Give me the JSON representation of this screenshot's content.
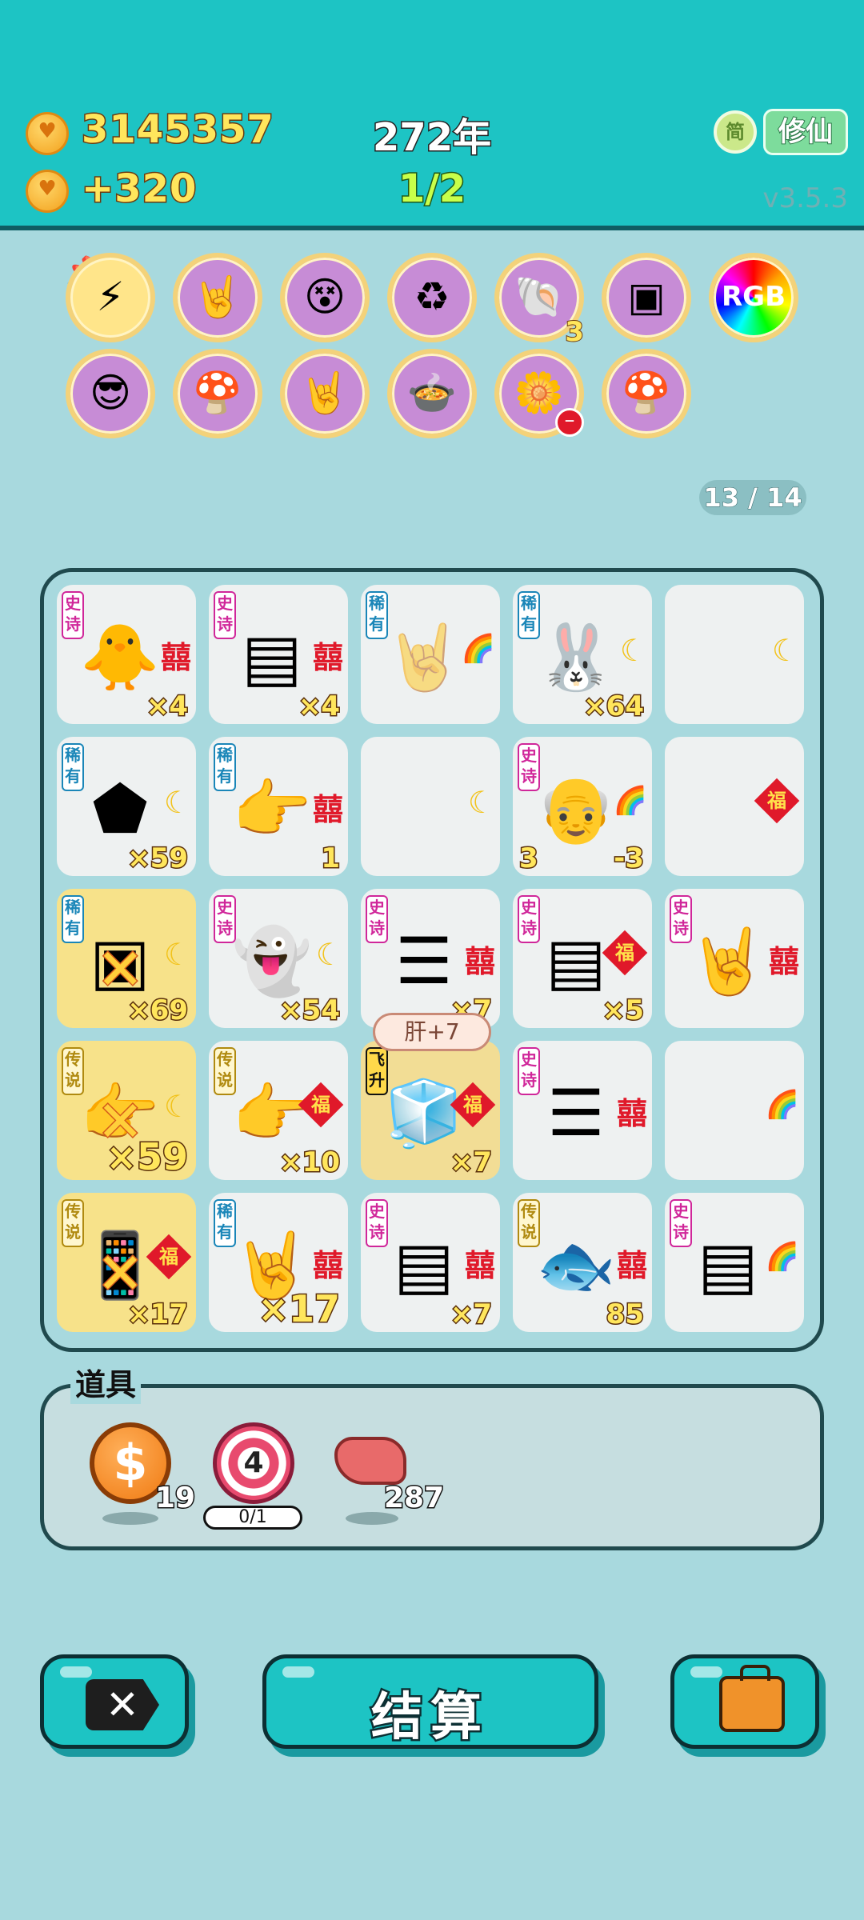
{
  "header": {
    "gold": "3145357",
    "income": "+320",
    "year": "272年",
    "round": "1/2",
    "simplified_label": "简",
    "mode_label": "修仙",
    "version": "v3.5.3"
  },
  "colors": {
    "header_bg": "#1dc4c4",
    "page_bg": "#a8d9de",
    "epic_tag": "#d0279a",
    "rare_tag": "#1a86b8",
    "legend_tag": "#b08a10",
    "gold_text": "#ffe65c"
  },
  "items": {
    "row1": [
      {
        "icon": "lightning-icon",
        "glyph": "⚡"
      },
      {
        "icon": "rock-hand-icon",
        "glyph": "🤘"
      },
      {
        "icon": "confused-face-icon",
        "glyph": "😵"
      },
      {
        "icon": "recycle-icon",
        "glyph": "♻"
      },
      {
        "icon": "shell-icon",
        "glyph": "🐚",
        "badge": "3"
      },
      {
        "icon": "cpu-chip-icon",
        "glyph": "▣"
      },
      {
        "icon": "rgb-icon",
        "glyph": "RGB"
      }
    ],
    "row2": [
      {
        "icon": "cool-peach-icon",
        "glyph": "😎"
      },
      {
        "icon": "mushroom-cloud-icon",
        "glyph": "🍄"
      },
      {
        "icon": "rock-hand-icon",
        "glyph": "🤘"
      },
      {
        "icon": "rice-cooker-icon",
        "glyph": "🍲"
      },
      {
        "icon": "potted-flower-icon",
        "glyph": "🌼"
      },
      {
        "icon": "mushroom-cloud-icon",
        "glyph": "🍄"
      }
    ]
  },
  "page_count": "13 / 14",
  "board": {
    "cells": [
      {
        "tag": "史诗",
        "tag_type": "epic",
        "icon": "chick-face-icon",
        "glyph": "🐥",
        "mark": "囍",
        "mark_type": "xi",
        "count": "×4"
      },
      {
        "tag": "史诗",
        "tag_type": "epic",
        "icon": "graphics-card-icon",
        "glyph": "▤",
        "mark": "囍",
        "mark_type": "xi",
        "count": "×4"
      },
      {
        "tag": "稀有",
        "tag_type": "rare",
        "icon": "graphics-card-ghost-icon",
        "glyph": "🤘",
        "mark": "🌈",
        "mark_type": "rain",
        "count": ""
      },
      {
        "tag": "稀有",
        "tag_type": "rare",
        "icon": "rabbit-icon",
        "glyph": "🐰",
        "mark": "☾",
        "mark_type": "moon",
        "count": "×64"
      },
      {
        "tag": "",
        "tag_type": "",
        "icon": "moon-icon",
        "glyph": "",
        "mark": "☾",
        "mark_type": "moon",
        "count": ""
      },
      {
        "tag": "稀有",
        "tag_type": "rare",
        "icon": "gold-ingot-icon",
        "glyph": "⬟",
        "mark": "☾",
        "mark_type": "moon",
        "count": "×59"
      },
      {
        "tag": "稀有",
        "tag_type": "rare",
        "icon": "pointing-hand-icon",
        "glyph": "👉",
        "mark": "囍",
        "mark_type": "xi",
        "count": "1"
      },
      {
        "tag": "",
        "tag_type": "",
        "icon": "moon-icon",
        "glyph": "",
        "mark": "☾",
        "mark_type": "moon",
        "count": ""
      },
      {
        "tag": "史诗",
        "tag_type": "epic",
        "icon": "old-man-face-icon",
        "glyph": "👴",
        "mark": "🌈",
        "mark_type": "rain",
        "count": "-3",
        "left_count": "3"
      },
      {
        "tag": "",
        "tag_type": "",
        "icon": "fu-icon",
        "glyph": "",
        "mark": "福",
        "mark_type": "fu",
        "count": ""
      },
      {
        "tag": "稀有",
        "tag_type": "rare",
        "icon": "cpu-chip-icon",
        "glyph": "▣",
        "mark": "☾",
        "mark_type": "moon",
        "count": "×69",
        "hl": "hl",
        "x": true
      },
      {
        "tag": "史诗",
        "tag_type": "epic",
        "icon": "ghost-icon",
        "glyph": "👻",
        "mark": "☾",
        "mark_type": "moon",
        "count": "×54"
      },
      {
        "tag": "史诗",
        "tag_type": "epic",
        "icon": "server-rack-icon",
        "glyph": "☰",
        "mark": "囍",
        "mark_type": "xi",
        "count": "×7"
      },
      {
        "tag": "史诗",
        "tag_type": "epic",
        "icon": "graphics-card-icon",
        "glyph": "▤",
        "mark": "福",
        "mark_type": "fu",
        "count": "×5"
      },
      {
        "tag": "史诗",
        "tag_type": "epic",
        "icon": "rock-hand-icon",
        "glyph": "🤘",
        "mark": "囍",
        "mark_type": "xi",
        "count": ""
      },
      {
        "tag": "传说",
        "tag_type": "legend",
        "icon": "pointing-hand-icon",
        "glyph": "👉",
        "mark": "☾",
        "mark_type": "moon",
        "count": "×59",
        "hl": "hl",
        "x": true,
        "big": true
      },
      {
        "tag": "传说",
        "tag_type": "legend",
        "icon": "pointing-hand-icon",
        "glyph": "👉",
        "mark": "福",
        "mark_type": "fu",
        "count": "×10"
      },
      {
        "tag": "飞升",
        "tag_type": "fly",
        "icon": "fridge-icon",
        "glyph": "🧊",
        "mark": "福",
        "mark_type": "fu",
        "count": "×7",
        "hl": "hl2"
      },
      {
        "tag": "史诗",
        "tag_type": "epic",
        "icon": "server-rack-icon",
        "glyph": "☰",
        "mark": "囍",
        "mark_type": "xi",
        "count": ""
      },
      {
        "tag": "",
        "tag_type": "",
        "icon": "rainbow-icon",
        "glyph": "",
        "mark": "🌈",
        "mark_type": "rain",
        "count": ""
      },
      {
        "tag": "传说",
        "tag_type": "legend",
        "icon": "phone-icon",
        "glyph": "📱",
        "mark": "福",
        "mark_type": "fu",
        "count": "×17",
        "hl": "hl",
        "x": true
      },
      {
        "tag": "稀有",
        "tag_type": "rare",
        "icon": "rock-hand-icon",
        "glyph": "🤘",
        "mark": "囍",
        "mark_type": "xi",
        "count": "×17",
        "big": true
      },
      {
        "tag": "史诗",
        "tag_type": "epic",
        "icon": "graphics-card-icon",
        "glyph": "▤",
        "mark": "囍",
        "mark_type": "xi",
        "count": "×7"
      },
      {
        "tag": "传说",
        "tag_type": "legend",
        "icon": "koi-fish-icon",
        "glyph": "🐟",
        "mark": "囍",
        "mark_type": "xi",
        "count": "85"
      },
      {
        "tag": "史诗",
        "tag_type": "epic",
        "icon": "graphics-card-icon",
        "glyph": "▤",
        "mark": "🌈",
        "mark_type": "rain",
        "count": ""
      }
    ],
    "liver_bubble": "肝+7"
  },
  "props": {
    "title": "道具",
    "coin_count": "19",
    "target_number": "4",
    "target_limit": "0/1",
    "liver_count": "287"
  },
  "buttons": {
    "settle_label": "结算"
  }
}
